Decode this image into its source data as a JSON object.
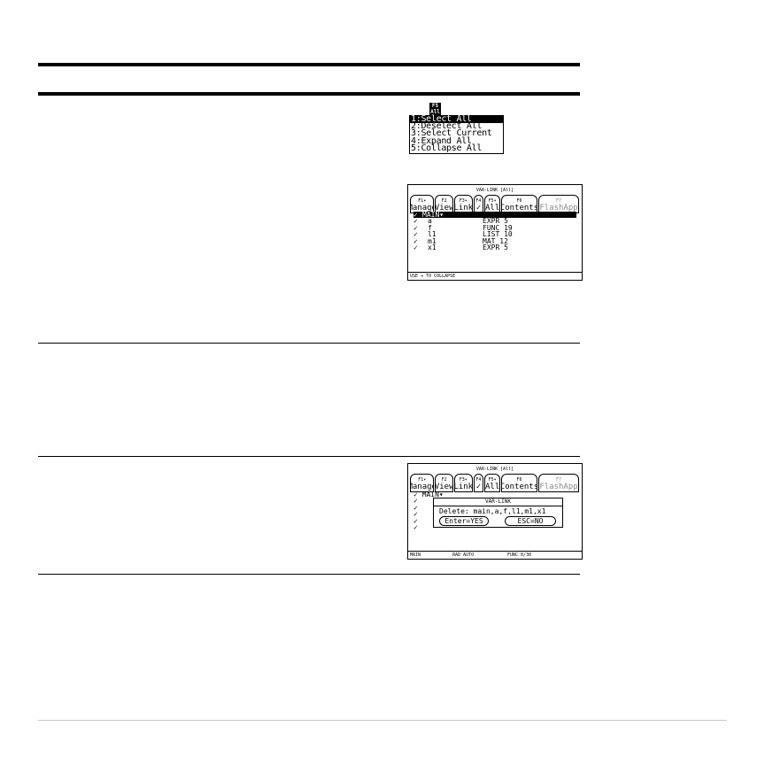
{
  "menu": {
    "tab_label": "F5\nAll",
    "items": [
      "1:Select All",
      "2:Deselect All",
      "3:Select Current",
      "4:Expand All",
      "5:Collapse All"
    ],
    "selected_index": 0
  },
  "screen1": {
    "title": "VAR-LINK [All]",
    "toolbar": [
      {
        "fn": "F1▾",
        "label": "Manage"
      },
      {
        "fn": "F2",
        "label": "View"
      },
      {
        "fn": "F3▾",
        "label": "Link"
      },
      {
        "fn": "F4",
        "label": "✓"
      },
      {
        "fn": "F5▾",
        "label": "All"
      },
      {
        "fn": "F6",
        "label": "Contents"
      },
      {
        "fn": "F7",
        "label": "FlashApp"
      }
    ],
    "rows": [
      {
        "chk": "✓",
        "name": "MAIN▾",
        "type": "",
        "size": ""
      },
      {
        "chk": "✓",
        "name": "a",
        "type": "EXPR",
        "size": "5"
      },
      {
        "chk": "✓",
        "name": "f",
        "type": "FUNC",
        "size": "19"
      },
      {
        "chk": "✓",
        "name": "l1",
        "type": "LIST",
        "size": "10"
      },
      {
        "chk": "✓",
        "name": "m1",
        "type": "MAT",
        "size": "12"
      },
      {
        "chk": "✓",
        "name": "x1",
        "type": "EXPR",
        "size": "5"
      }
    ],
    "status": "USE ◂ TO COLLAPSE"
  },
  "screen2": {
    "title": "VAR-LINK [All]",
    "toolbar": [
      {
        "fn": "F1▾",
        "label": "Manage"
      },
      {
        "fn": "F2",
        "label": "View"
      },
      {
        "fn": "F3▾",
        "label": "Link"
      },
      {
        "fn": "F4",
        "label": "✓"
      },
      {
        "fn": "F5▾",
        "label": "All"
      },
      {
        "fn": "F6",
        "label": "Contents"
      },
      {
        "fn": "F7",
        "label": "FlashApp"
      }
    ],
    "first_row": "✓ MAIN▾",
    "checks": [
      "✓",
      "✓",
      "✓",
      "✓",
      "✓"
    ],
    "dialog": {
      "title": "VAR-LINK",
      "text": "Delete: main,a,f,l1,m1,x1",
      "yes": "Enter=YES",
      "no": "ESC=NO"
    },
    "status": [
      "MAIN",
      "RAD AUTO",
      "FUNC 0/30"
    ]
  }
}
